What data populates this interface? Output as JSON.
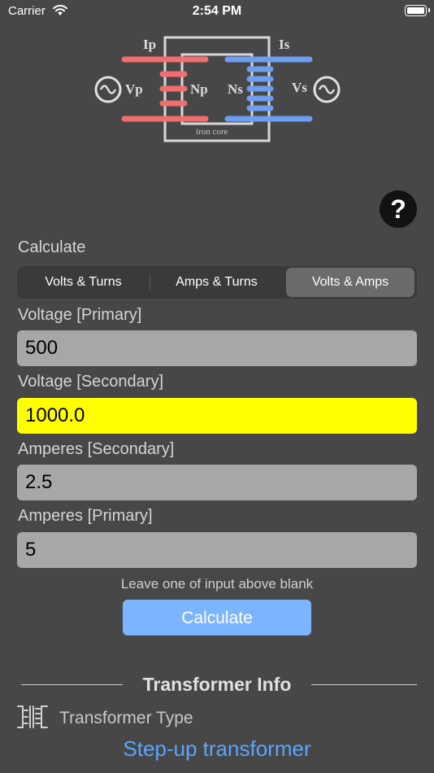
{
  "status_bar": {
    "carrier": "Carrier",
    "time": "2:54 PM"
  },
  "diagram": {
    "ip": "Ip",
    "is": "Is",
    "vp": "Vp",
    "vs": "Vs",
    "np": "Np",
    "ns": "Ns",
    "core": "iron core",
    "colors": {
      "primary": "#f26d6d",
      "secondary": "#6d9ef2"
    }
  },
  "help_label": "?",
  "calculate_label": "Calculate",
  "segments": [
    {
      "label": "Volts & Turns",
      "selected": false
    },
    {
      "label": "Amps & Turns",
      "selected": false
    },
    {
      "label": "Volts & Amps",
      "selected": true
    }
  ],
  "fields": [
    {
      "label": "Voltage [Primary]",
      "value": "500"
    },
    {
      "label": "Voltage [Secondary]",
      "value": "1000.0",
      "highlight": true
    },
    {
      "label": "Amperes [Secondary]",
      "value": "2.5"
    },
    {
      "label": "Amperes [Primary]",
      "value": "5"
    }
  ],
  "hint": "Leave one of input above blank",
  "calculate_button": "Calculate",
  "info": {
    "title": "Transformer Info",
    "type_label": "Transformer Type",
    "type_value": "Step-up transformer"
  },
  "colors": {
    "accent": "#57a6ff",
    "button": "#7cb5ff",
    "highlight": "#ffff00",
    "background": "#474747"
  }
}
